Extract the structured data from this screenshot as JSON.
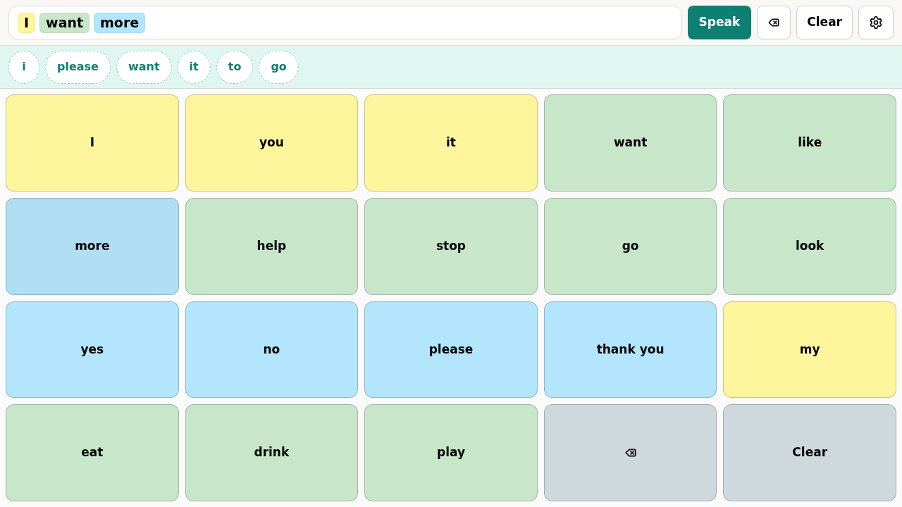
{
  "message_bar": {
    "words": [
      {
        "label": "I",
        "color": "#fff59d"
      },
      {
        "label": "want",
        "color": "#c8e6c9"
      },
      {
        "label": "more",
        "color": "#b3e5fc"
      }
    ]
  },
  "toolbar": [
    {
      "kind": "speak",
      "label": "Speak"
    },
    {
      "kind": "backspace"
    },
    {
      "kind": "clear",
      "label": "Clear"
    },
    {
      "kind": "settings"
    }
  ],
  "suggestions": [
    "i",
    "please",
    "want",
    "it",
    "to",
    "go"
  ],
  "tiles": [
    {
      "kind": "word",
      "label": "I",
      "color": "#fff59d"
    },
    {
      "kind": "word",
      "label": "you",
      "color": "#fff59d"
    },
    {
      "kind": "word",
      "label": "it",
      "color": "#fff59d"
    },
    {
      "kind": "word",
      "label": "want",
      "color": "#c8e6c9"
    },
    {
      "kind": "word",
      "label": "like",
      "color": "#c8e6c9"
    },
    {
      "kind": "word",
      "label": "more",
      "color": "#b0def3"
    },
    {
      "kind": "word",
      "label": "help",
      "color": "#c8e6c9"
    },
    {
      "kind": "word",
      "label": "stop",
      "color": "#c8e6c9"
    },
    {
      "kind": "word",
      "label": "go",
      "color": "#c8e6c9"
    },
    {
      "kind": "word",
      "label": "look",
      "color": "#c8e6c9"
    },
    {
      "kind": "word",
      "label": "yes",
      "color": "#b3e5fc"
    },
    {
      "kind": "word",
      "label": "no",
      "color": "#b3e5fc"
    },
    {
      "kind": "word",
      "label": "please",
      "color": "#b3e5fc"
    },
    {
      "kind": "word",
      "label": "thank you",
      "color": "#b3e5fc"
    },
    {
      "kind": "word",
      "label": "my",
      "color": "#fff59d"
    },
    {
      "kind": "word",
      "label": "eat",
      "color": "#c8e6c9"
    },
    {
      "kind": "word",
      "label": "drink",
      "color": "#c8e6c9"
    },
    {
      "kind": "word",
      "label": "play",
      "color": "#c8e6c9"
    },
    {
      "kind": "backspace",
      "color": "#cfd8dc"
    },
    {
      "kind": "word",
      "label": "Clear",
      "color": "#cfd8dc"
    }
  ]
}
